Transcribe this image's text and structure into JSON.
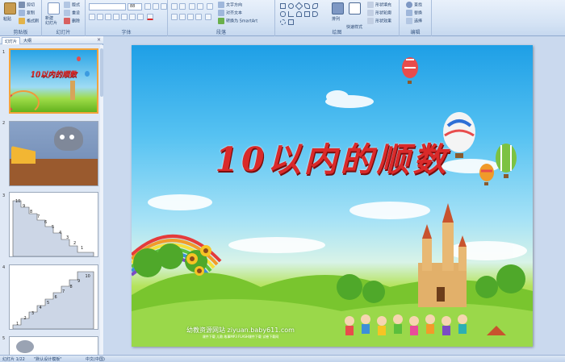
{
  "ribbon": {
    "clipboard": {
      "group_label": "剪贴板",
      "paste_label": "粘贴",
      "cut_label": "剪切",
      "copy_label": "复制",
      "painter_label": "格式刷"
    },
    "slides": {
      "group_label": "幻灯片",
      "new_slide_label": "新建\n幻灯片",
      "layout_label": "版式",
      "reset_label": "重设",
      "delete_label": "删除"
    },
    "font": {
      "group_label": "字体",
      "font_name": "",
      "font_size": "88"
    },
    "paragraph": {
      "group_label": "段落",
      "text_direction_label": "文字方向",
      "align_text_label": "对齐文本",
      "smartart_label": "转换为 SmartArt"
    },
    "drawing": {
      "group_label": "绘图",
      "arrange_label": "排列",
      "quick_styles_label": "快速样式",
      "shape_fill_label": "形状填充",
      "shape_outline_label": "形状轮廓",
      "shape_effects_label": "形状效果"
    },
    "editing": {
      "group_label": "编辑",
      "find_label": "查找",
      "replace_label": "替换",
      "select_label": "选择"
    }
  },
  "left_panel": {
    "tab_slides": "幻灯片",
    "tab_outline": "大纲",
    "close_glyph": "×",
    "thumbnails": [
      {
        "number": "1",
        "caption": "10以内的顺数",
        "selected": true
      },
      {
        "number": "2",
        "caption": "",
        "selected": false
      },
      {
        "number": "3",
        "caption": "",
        "selected": false
      },
      {
        "number": "4",
        "caption": "",
        "selected": false
      },
      {
        "number": "5",
        "caption": "",
        "selected": false
      }
    ],
    "stair_numbers_3": [
      "1",
      "2",
      "3",
      "4",
      "5",
      "6",
      "7",
      "8",
      "9",
      "10"
    ],
    "stair_numbers_4": [
      "1",
      "2",
      "3",
      "4",
      "5",
      "6",
      "7",
      "8",
      "9",
      "10"
    ]
  },
  "slide": {
    "title": "10以内的顺数",
    "watermark_line1": "幼教资源网站  ziyuan.baby611.com",
    "watermark_line2": "课件下载 儿歌 故事MP3 FLASH课件下载 试卷下载网"
  },
  "statusbar": {
    "slide_counter": "幻灯片 1/22",
    "theme": "\"默认设计模板\"",
    "language": "中文(中国)"
  },
  "colors": {
    "title_red": "#d92a2a",
    "selection_orange": "#f4a33b",
    "ribbon_blue": "#d3e2f4"
  },
  "icons": [
    "paste-icon",
    "cut-icon",
    "copy-icon",
    "format-painter-icon",
    "new-slide-icon",
    "bold-icon",
    "italic-icon",
    "align-icon",
    "arrange-icon",
    "find-icon",
    "replace-icon",
    "select-icon",
    "balloon-icon"
  ]
}
